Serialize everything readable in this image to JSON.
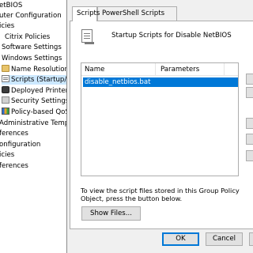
{
  "tree": {
    "items": [
      {
        "label": "etBIOS",
        "icon": "none"
      },
      {
        "label": "uter Configuration",
        "icon": "none"
      },
      {
        "label": "icies",
        "icon": "none"
      },
      {
        "label": "Citrix Policies",
        "icon": "none"
      },
      {
        "label": "Software Settings",
        "icon": "none"
      },
      {
        "label": "Windows Settings",
        "icon": "none"
      },
      {
        "label": "Name Resolution",
        "icon": "folder-icon"
      },
      {
        "label": "Scripts (Startup/S",
        "icon": "script-icon",
        "selected": true
      },
      {
        "label": "Deployed Printers",
        "icon": "printer-icon"
      },
      {
        "label": "Security Settings",
        "icon": "security-icon"
      },
      {
        "label": "Policy-based QoS",
        "icon": "qos-chart-icon"
      },
      {
        "label": "Administrative Temp",
        "icon": "none"
      },
      {
        "label": "ferences",
        "icon": "none"
      },
      {
        "label": "onfiguration",
        "icon": "none"
      },
      {
        "label": "icies",
        "icon": "none"
      },
      {
        "label": "ferences",
        "icon": "none"
      }
    ]
  },
  "dialog": {
    "tabs": [
      {
        "label": "Scripts",
        "active": true
      },
      {
        "label": "PowerShell Scripts",
        "active": false
      }
    ],
    "header_text": "Startup Scripts for Disable NetBIOS",
    "list": {
      "columns": [
        "Name",
        "Parameters"
      ],
      "rows": [
        {
          "name": "disable_netbios.bat",
          "parameters": "",
          "selected": true
        }
      ]
    },
    "info_text": "To view the script files stored in this Group Policy Object, press the button below.",
    "show_files_label": "Show Files...",
    "ok_label": "OK",
    "cancel_label": "Cancel"
  },
  "colors": {
    "selection": "#0078d7",
    "tree_selection": "#cce8ff",
    "dialog_bg": "#f0f0f0"
  }
}
